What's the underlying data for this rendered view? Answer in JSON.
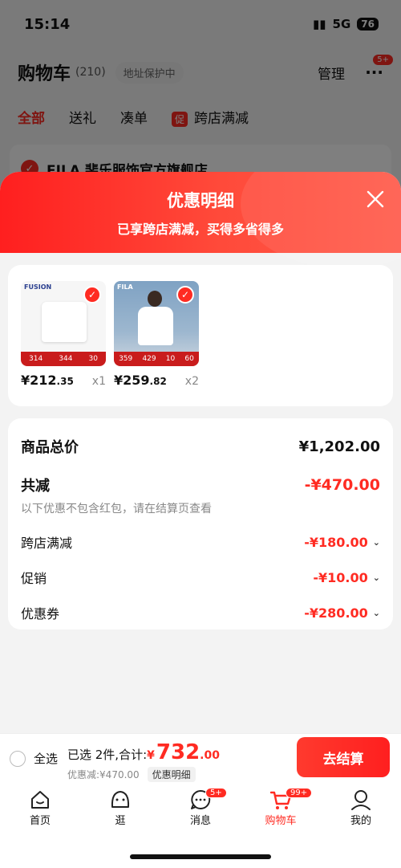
{
  "status": {
    "time": "15:14",
    "network": "5G",
    "battery": "76"
  },
  "cart_page": {
    "title": "购物车",
    "count": "(210)",
    "address_chip": "地址保护中",
    "manage": "管理",
    "more_badge": "5+",
    "tabs": [
      "全部",
      "送礼",
      "凑单",
      "跨店满减"
    ],
    "promo_tag": "促",
    "store_name": "FILA 斐乐服饰官方旗舰店"
  },
  "sheet": {
    "title": "优惠明细",
    "subtitle": "已享跨店满减，买得多省得多",
    "products": [
      {
        "brand": "FUSION",
        "price": "¥212",
        "price_decimal": ".35",
        "qty": "x1",
        "strip": [
          "314",
          "344",
          "30"
        ]
      },
      {
        "brand": "FILA",
        "price": "¥259",
        "price_decimal": ".82",
        "qty": "x2",
        "strip": [
          "359",
          "429",
          "10",
          "60"
        ]
      }
    ],
    "summary": {
      "total_label": "商品总价",
      "total_value": "¥1,202.00",
      "reduce_label": "共减",
      "reduce_value": "-¥470.00",
      "note": "以下优惠不包含红包，请在结算页查看",
      "details": [
        {
          "label": "跨店满减",
          "value": "-¥180.00"
        },
        {
          "label": "促销",
          "value": "-¥10.00"
        },
        {
          "label": "优惠券",
          "value": "-¥280.00"
        }
      ]
    }
  },
  "checkout": {
    "select_all": "全选",
    "selected_text": "已选 2件,合计:",
    "yen": "¥",
    "total_int": "732",
    "total_dec": ".00",
    "discount_text": "优惠减:¥470.00",
    "detail_chip": "优惠明细",
    "button": "去结算"
  },
  "tabbar": [
    {
      "label": "首页",
      "icon": "home-icon"
    },
    {
      "label": "逛",
      "icon": "browse-face-icon"
    },
    {
      "label": "消息",
      "icon": "message-icon",
      "badge": "5+"
    },
    {
      "label": "购物车",
      "icon": "cart-icon",
      "badge": "99+",
      "active": true
    },
    {
      "label": "我的",
      "icon": "profile-icon"
    }
  ],
  "colors": {
    "accent": "#ff2b22",
    "overlay": "rgba(0,0,0,0.5)"
  }
}
